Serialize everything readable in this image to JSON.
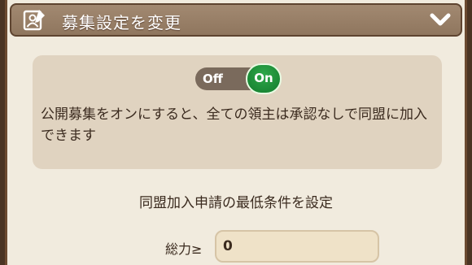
{
  "header": {
    "title": "募集設定を変更",
    "icon": "recruit-settings-icon",
    "collapse_icon": "chevron-down-icon"
  },
  "recruitment_toggle": {
    "off_label": "Off",
    "on_label": "On",
    "state": "on",
    "on_color": "#1e9b3b"
  },
  "description": "公開募集をオンにすると、全ての領主は承認なしで同盟に加入できます",
  "requirements": {
    "title": "同盟加入申請の最低条件を設定",
    "power_label": "総力≥",
    "power_value": "0"
  }
}
